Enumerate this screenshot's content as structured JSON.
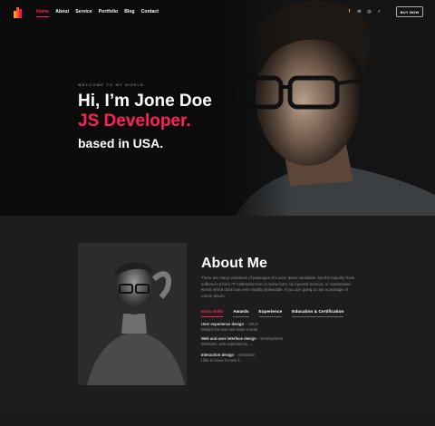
{
  "nav": {
    "items": [
      {
        "label": "Home",
        "active": true
      },
      {
        "label": "About"
      },
      {
        "label": "Service"
      },
      {
        "label": "Portfolio"
      },
      {
        "label": "Blog"
      },
      {
        "label": "Contact"
      }
    ],
    "social": [
      {
        "icon": "facebook-icon",
        "glyph": "f"
      },
      {
        "icon": "linkedin-icon",
        "glyph": "in"
      },
      {
        "icon": "instagram-icon",
        "glyph": "◎"
      },
      {
        "icon": "twitter-icon",
        "glyph": "✓"
      }
    ],
    "buy_label": "BUY NOW"
  },
  "hero": {
    "welcome": "WELCOME TO MY WORLD",
    "line1": "Hi, I’m Jone Doe",
    "line2": "JS Developer.",
    "line3": "based in USA."
  },
  "about": {
    "title": "About Me",
    "text": "There are many variations of passages of Lorem Ipsum available, but the majority have suffered <a href=\"#\">alteration</a> in some form, by injected humour, or randomised words which dont look even slightly believable. If you are going to use a passage of Lorem Ipsum.",
    "tabs": [
      {
        "label": "Main skills",
        "active": true
      },
      {
        "label": "Awards"
      },
      {
        "label": "Experience"
      },
      {
        "label": "Education & Certification"
      }
    ],
    "skills": [
      {
        "title": "User experience design",
        "tag": "UI/UX",
        "desc": "Delight the user and make it work."
      },
      {
        "title": "Web and user interface design",
        "tag": "Development",
        "desc": "Websites, web experiences, ..."
      },
      {
        "title": "Interaction design",
        "tag": "Animation",
        "desc": "I like to move it move it."
      }
    ]
  },
  "colors": {
    "accent": "#ff1f5a",
    "background": "#1c1c1c",
    "hero_background": "#0b0b0b"
  }
}
